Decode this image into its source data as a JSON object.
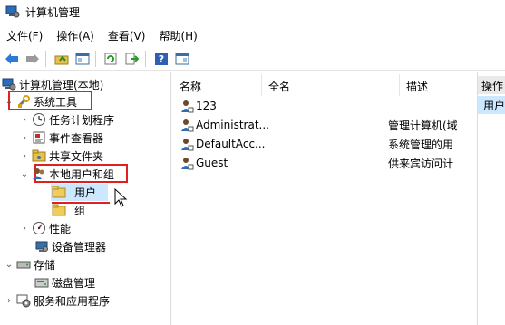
{
  "window": {
    "title": "计算机管理"
  },
  "menu": [
    "文件(F)",
    "操作(A)",
    "查看(V)",
    "帮助(H)"
  ],
  "toolbar": {
    "buttons": [
      "back-icon",
      "forward-icon",
      "up-folder-icon",
      "show-hide-tree-icon",
      "refresh-icon",
      "export-list-icon",
      "help-icon",
      "properties-icon"
    ]
  },
  "tree": {
    "root": "计算机管理(本地)",
    "system_tools": "系统工具",
    "task_scheduler": "任务计划程序",
    "event_viewer": "事件查看器",
    "shared_folders": "共享文件夹",
    "local_users_groups": "本地用户和组",
    "users": "用户",
    "groups": "组",
    "performance": "性能",
    "device_manager": "设备管理器",
    "storage": "存储",
    "disk_management": "磁盘管理",
    "services_apps": "服务和应用程序"
  },
  "list": {
    "columns": [
      "名称",
      "全名",
      "描述"
    ],
    "rows": [
      {
        "name": "123",
        "fullname": "",
        "desc": ""
      },
      {
        "name": "Administrat...",
        "fullname": "",
        "desc": "管理计算机(域"
      },
      {
        "name": "DefaultAcc...",
        "fullname": "",
        "desc": "系统管理的用"
      },
      {
        "name": "Guest",
        "fullname": "",
        "desc": "供来宾访问计"
      }
    ]
  },
  "actions": {
    "header": "操作",
    "item": "用户"
  },
  "colors": {
    "highlight": "#e02020",
    "selection": "#cce8ff"
  }
}
